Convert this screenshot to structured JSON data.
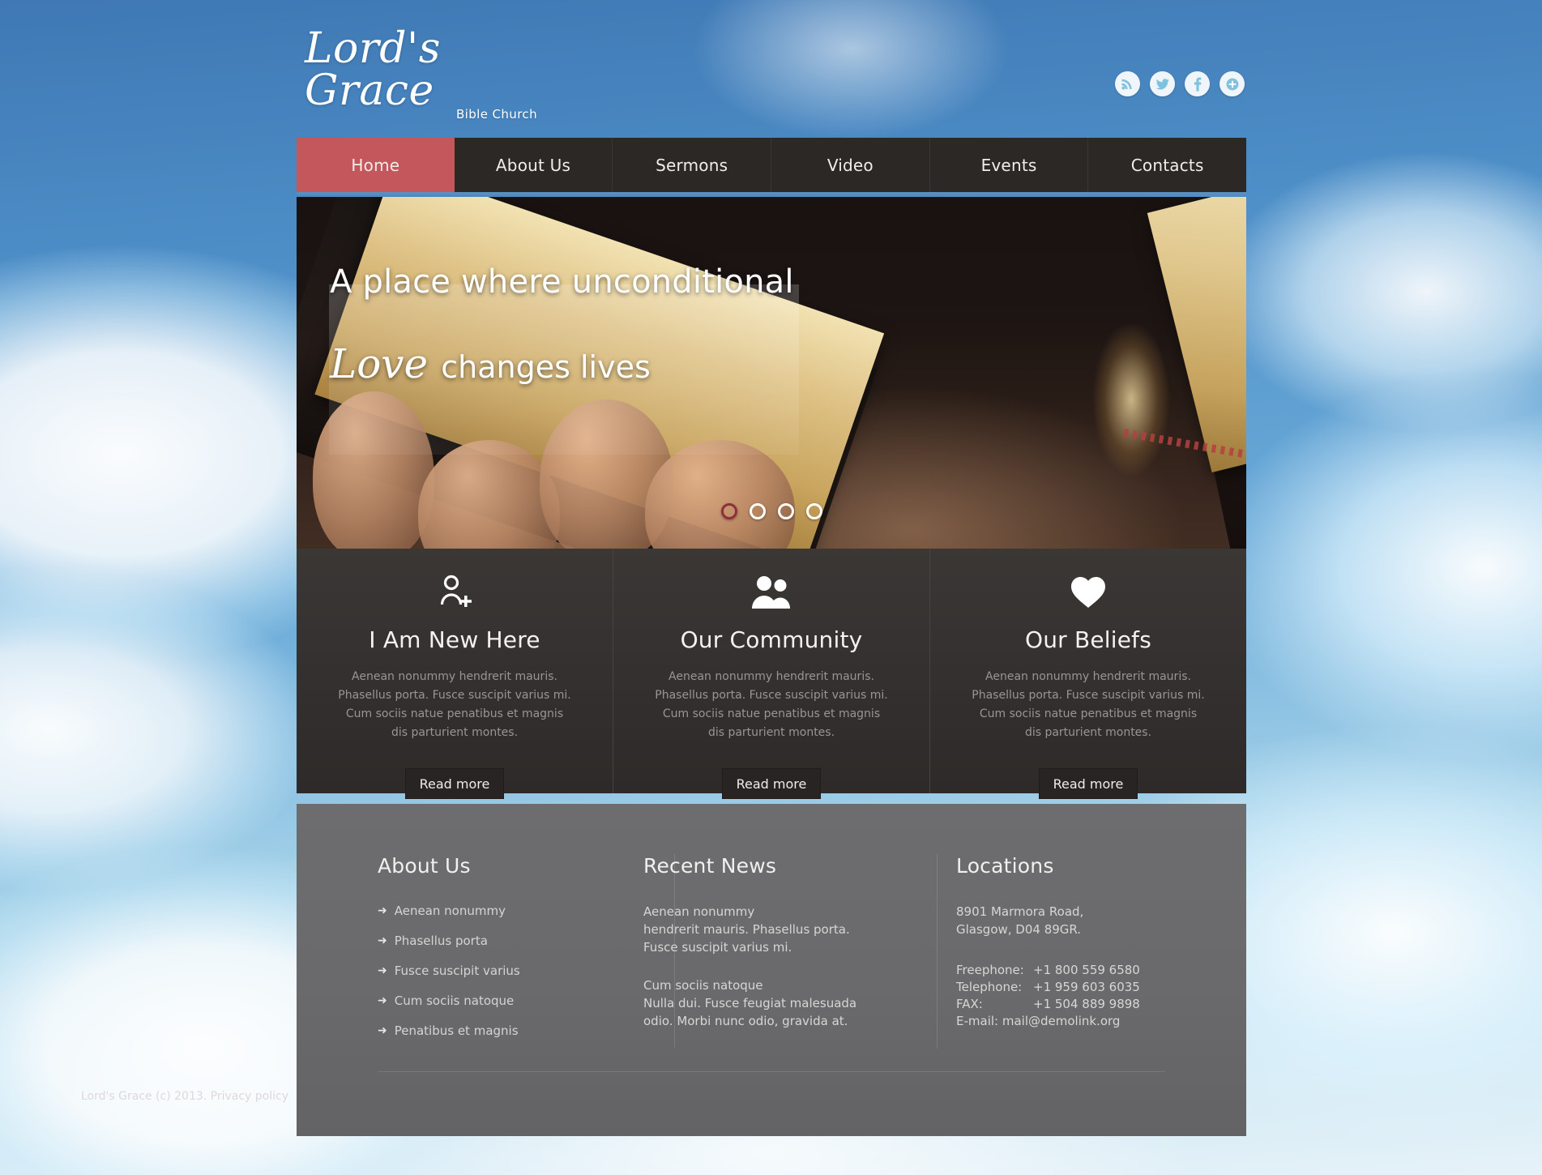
{
  "header": {
    "logo_main": "Lord's Grace",
    "logo_sub": "Bible Church",
    "social": [
      {
        "name": "rss-icon",
        "label": "RSS"
      },
      {
        "name": "twitter-icon",
        "label": "Twitter"
      },
      {
        "name": "facebook-icon",
        "label": "Facebook"
      },
      {
        "name": "share-plus-icon",
        "label": "Share"
      }
    ]
  },
  "nav": {
    "active_index": 0,
    "items": [
      {
        "label": "Home"
      },
      {
        "label": "About Us"
      },
      {
        "label": "Sermons"
      },
      {
        "label": "Video"
      },
      {
        "label": "Events"
      },
      {
        "label": "Contacts"
      }
    ]
  },
  "hero": {
    "line1": "A place where unconditional",
    "line2_script": "Love",
    "line2_rest": " changes lives",
    "dots": 4,
    "active_dot": 0,
    "active_dot_color": "#8e2f3b",
    "image_description": "Hands holding an open black leather Bible with gilded page edges and a gold cross"
  },
  "features": {
    "body_text": "Aenean nonummy hendrerit mauris. Phasellus porta. Fusce suscipit varius mi. Cum sociis natue penatibus et magnis dis parturient montes.",
    "read_more_label": "Read more",
    "items": [
      {
        "title": "I Am New Here",
        "icon": "person-add-icon"
      },
      {
        "title": "Our Community",
        "icon": "people-group-icon"
      },
      {
        "title": "Our Beliefs",
        "icon": "heart-icon"
      }
    ]
  },
  "footer": {
    "about": {
      "title": "About Us",
      "bullet": "➜",
      "links": [
        "Aenean nonummy",
        "Phasellus porta",
        "Fusce suscipit varius",
        "Cum sociis natoque",
        "Penatibus et magnis"
      ]
    },
    "news": {
      "title": "Recent News",
      "items": [
        {
          "heading": "Aenean nonummy",
          "body": "hendrerit mauris. Phasellus porta. Fusce suscipit varius mi."
        },
        {
          "heading": "Cum sociis natoque",
          "body": "Nulla dui. Fusce feugiat malesuada odio. Morbi nunc odio, gravida at."
        }
      ]
    },
    "locations": {
      "title": "Locations",
      "address_line1": "8901 Marmora Road,",
      "address_line2": "Glasgow, D04 89GR.",
      "contacts": [
        {
          "label": "Freephone:",
          "value": "+1 800 559 6580"
        },
        {
          "label": "Telephone:",
          "value": "+1 959 603 6035"
        },
        {
          "label": "FAX:",
          "value": "+1 504 889 9898"
        }
      ],
      "email_label": "E-mail:",
      "email": "mail@demolink.org"
    },
    "copyright": "Lord's Grace (c) 2013. Privacy policy"
  },
  "colors": {
    "accent_red": "#c4575c",
    "nav_bg": "#2c2826",
    "features_bg": "#353130",
    "footer_bg": "#6d6d6f",
    "nav_underline_blue": "#5b8fc0"
  }
}
